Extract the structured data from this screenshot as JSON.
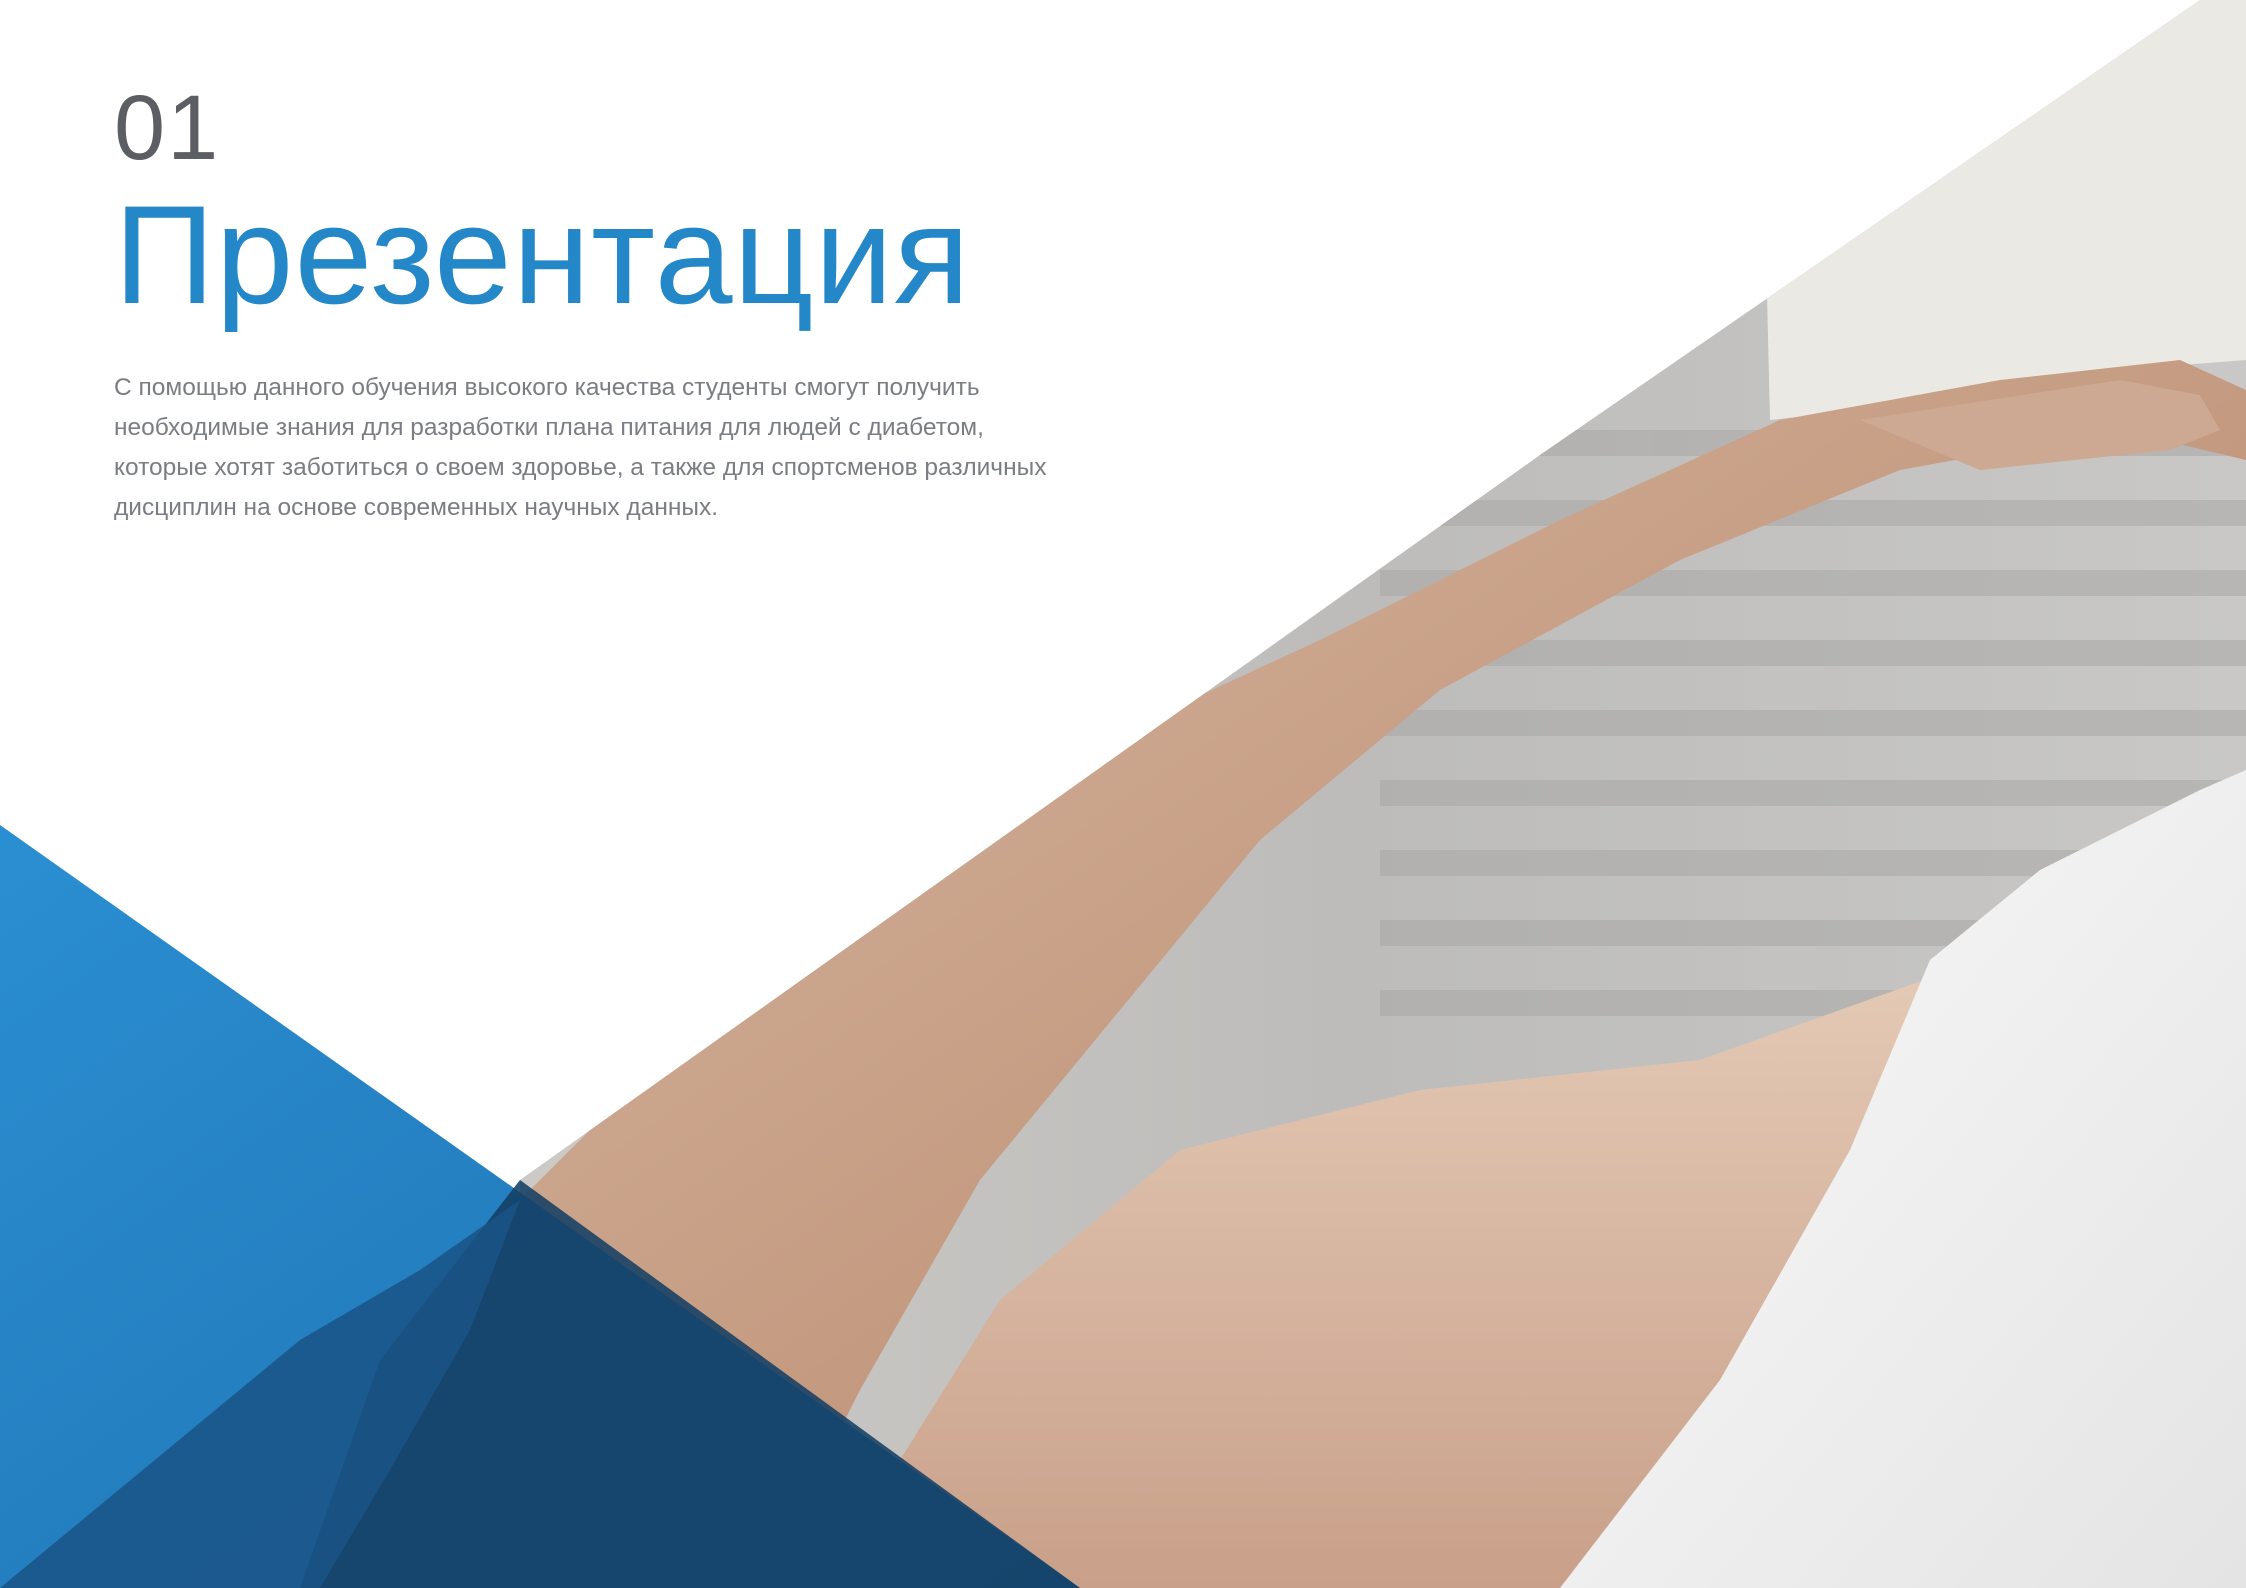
{
  "slide": {
    "number": "01",
    "title": "Презентация",
    "body": "С помощью данного обучения высокого качества студенты смогут получить необходимые знания для разработки плана питания для людей с диабетом, которые хотят заботиться о своем здоровье, а также для спортсменов различных дисциплин на основе современных научных данных."
  },
  "colors": {
    "accent_blue": "#2487c8",
    "number_gray": "#5b5e63",
    "body_gray": "#7a7d82",
    "dark_blue": "#143f63"
  }
}
